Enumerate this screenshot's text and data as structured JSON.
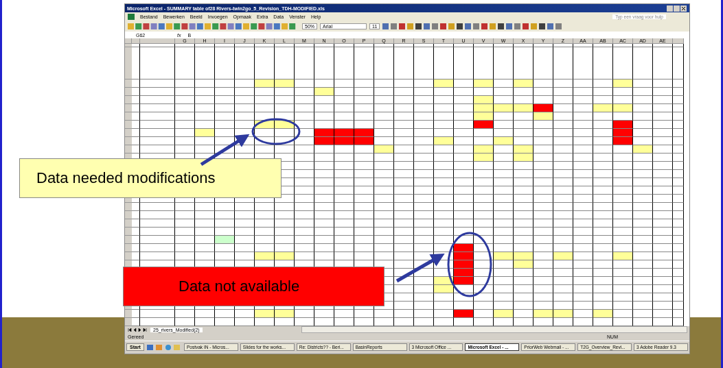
{
  "window": {
    "title": "Microsoft Excel - SUMMARY table of28 Rivers-twin2go_5_Revision_TDH-MODIFIED.xls"
  },
  "menu": [
    "Bestand",
    "Bewerken",
    "Beeld",
    "Invoegen",
    "Opmaak",
    "Extra",
    "Data",
    "Venster",
    "Help"
  ],
  "help_box": {
    "placeholder": "Typ een vraag voor hulp"
  },
  "toolbar": {
    "zoom": "50%",
    "font": "Arial",
    "size": "11"
  },
  "formula_bar": {
    "cell": "G62",
    "fx": "fx",
    "value": "B"
  },
  "columns": [
    "G",
    "H",
    "I",
    "J",
    "K",
    "L",
    "M",
    "N",
    "O",
    "P",
    "Q",
    "R",
    "S",
    "T",
    "U",
    "V",
    "W",
    "X",
    "Y",
    "Z",
    "AA",
    "AB",
    "AC",
    "AD",
    "AE"
  ],
  "rows": [
    {
      "cells": [
        {},
        {},
        {},
        {},
        {
          "color": "#ffff99"
        },
        {
          "color": "#ffff99"
        },
        {},
        {},
        {},
        {},
        {},
        {},
        {},
        {
          "color": "#ffff99"
        },
        {},
        {
          "color": "#ffff99"
        },
        {},
        {
          "color": "#ffff99"
        },
        {},
        {},
        {},
        {},
        {
          "color": "#ffff99"
        },
        {},
        {}
      ]
    },
    {
      "cells": [
        {},
        {},
        {},
        {},
        {},
        {},
        {},
        {
          "color": "#ffff99"
        },
        {},
        {},
        {},
        {},
        {},
        {},
        {},
        {},
        {},
        {},
        {},
        {},
        {},
        {},
        {},
        {},
        {}
      ]
    },
    {
      "cells": [
        {},
        {},
        {},
        {},
        {},
        {},
        {},
        {},
        {},
        {},
        {},
        {},
        {},
        {},
        {},
        {
          "color": "#ffff99"
        },
        {},
        {},
        {},
        {},
        {},
        {},
        {},
        {},
        {}
      ]
    },
    {
      "cells": [
        {},
        {},
        {},
        {},
        {},
        {},
        {},
        {},
        {},
        {},
        {},
        {},
        {},
        {},
        {},
        {
          "color": "#ffff99"
        },
        {
          "color": "#ffff99"
        },
        {
          "color": "#ffff99"
        },
        {
          "color": "#ff0000"
        },
        {},
        {},
        {
          "color": "#ffff99"
        },
        {
          "color": "#ffff99"
        },
        {},
        {}
      ]
    },
    {
      "cells": [
        {},
        {},
        {},
        {},
        {},
        {},
        {},
        {},
        {},
        {},
        {},
        {},
        {},
        {},
        {},
        {
          "color": "#ffff99"
        },
        {},
        {},
        {
          "color": "#ffff99"
        },
        {},
        {},
        {},
        {},
        {},
        {}
      ]
    },
    {
      "cells": [
        {},
        {},
        {},
        {},
        {
          "color": "#ffff99"
        },
        {
          "color": "#ffff99"
        },
        {},
        {},
        {},
        {},
        {},
        {},
        {},
        {},
        {},
        {
          "color": "#ff0000"
        },
        {},
        {},
        {},
        {},
        {},
        {},
        {
          "color": "#ff0000"
        },
        {},
        {}
      ]
    },
    {
      "cells": [
        {},
        {
          "color": "#ffff99"
        },
        {},
        {},
        {},
        {},
        {},
        {
          "color": "#ff0000"
        },
        {
          "color": "#ff0000"
        },
        {
          "color": "#ff0000"
        },
        {},
        {},
        {},
        {},
        {},
        {},
        {},
        {},
        {},
        {},
        {},
        {},
        {
          "color": "#ff0000"
        },
        {},
        {}
      ]
    },
    {
      "cells": [
        {},
        {},
        {},
        {},
        {},
        {},
        {},
        {
          "color": "#ff0000"
        },
        {
          "color": "#ff0000"
        },
        {
          "color": "#ff0000"
        },
        {},
        {},
        {},
        {
          "color": "#ffff99"
        },
        {},
        {},
        {
          "color": "#ffff99"
        },
        {},
        {},
        {},
        {},
        {},
        {
          "color": "#ff0000"
        },
        {},
        {}
      ]
    },
    {
      "cells": [
        {},
        {},
        {},
        {},
        {},
        {},
        {},
        {},
        {},
        {},
        {
          "color": "#ffff99"
        },
        {},
        {},
        {},
        {},
        {
          "color": "#ffff99"
        },
        {},
        {
          "color": "#ffff99"
        },
        {},
        {},
        {},
        {},
        {},
        {
          "color": "#ffff99"
        },
        {}
      ]
    },
    {
      "cells": [
        {},
        {},
        {},
        {},
        {},
        {},
        {},
        {},
        {},
        {},
        {},
        {},
        {},
        {},
        {},
        {
          "color": "#ffff99"
        },
        {},
        {
          "color": "#ffff99"
        },
        {},
        {},
        {},
        {},
        {},
        {},
        {}
      ]
    },
    {
      "cells": [
        {},
        {},
        {},
        {},
        {},
        {},
        {},
        {},
        {},
        {},
        {},
        {},
        {},
        {},
        {},
        {},
        {},
        {},
        {},
        {},
        {},
        {},
        {},
        {},
        {}
      ]
    },
    {
      "cells": [
        {},
        {},
        {},
        {},
        {},
        {},
        {},
        {},
        {},
        {},
        {},
        {},
        {},
        {},
        {},
        {},
        {},
        {},
        {},
        {},
        {},
        {},
        {},
        {},
        {}
      ]
    },
    {
      "cells": [
        {},
        {},
        {},
        {},
        {},
        {},
        {},
        {},
        {},
        {},
        {},
        {},
        {},
        {},
        {},
        {},
        {},
        {},
        {},
        {},
        {},
        {},
        {},
        {},
        {}
      ]
    },
    {
      "cells": [
        {},
        {},
        {},
        {},
        {},
        {},
        {},
        {},
        {},
        {},
        {},
        {},
        {},
        {},
        {},
        {},
        {},
        {},
        {},
        {},
        {},
        {},
        {},
        {},
        {}
      ]
    },
    {
      "cells": [
        {},
        {},
        {},
        {},
        {},
        {},
        {},
        {},
        {},
        {},
        {},
        {},
        {},
        {},
        {},
        {},
        {},
        {},
        {},
        {},
        {},
        {},
        {},
        {},
        {}
      ]
    },
    {
      "cells": [
        {},
        {},
        {},
        {},
        {},
        {},
        {},
        {},
        {},
        {},
        {},
        {},
        {},
        {},
        {},
        {},
        {},
        {},
        {},
        {},
        {},
        {},
        {},
        {},
        {}
      ]
    },
    {
      "cells": [
        {},
        {},
        {},
        {},
        {},
        {},
        {},
        {},
        {},
        {},
        {},
        {},
        {},
        {},
        {},
        {},
        {},
        {},
        {},
        {},
        {},
        {},
        {},
        {},
        {}
      ]
    },
    {
      "cells": [
        {},
        {},
        {},
        {},
        {},
        {},
        {},
        {},
        {},
        {},
        {},
        {},
        {},
        {},
        {},
        {},
        {},
        {},
        {},
        {},
        {},
        {},
        {},
        {},
        {}
      ]
    },
    {
      "cells": [
        {},
        {},
        {},
        {},
        {},
        {},
        {},
        {},
        {},
        {},
        {},
        {},
        {},
        {},
        {},
        {},
        {},
        {},
        {},
        {},
        {},
        {},
        {},
        {},
        {}
      ]
    },
    {
      "cells": [
        {},
        {},
        {
          "color": "#ccffcc"
        },
        {},
        {},
        {},
        {},
        {},
        {},
        {},
        {},
        {},
        {},
        {},
        {},
        {},
        {},
        {},
        {},
        {},
        {},
        {},
        {},
        {},
        {}
      ]
    },
    {
      "cells": [
        {},
        {},
        {},
        {},
        {},
        {},
        {},
        {},
        {},
        {},
        {},
        {},
        {},
        {},
        {
          "color": "#ff0000"
        },
        {},
        {},
        {},
        {},
        {},
        {},
        {},
        {},
        {},
        {}
      ]
    },
    {
      "cells": [
        {},
        {},
        {},
        {},
        {
          "color": "#ffff99"
        },
        {
          "color": "#ffff99"
        },
        {},
        {},
        {},
        {},
        {},
        {},
        {},
        {},
        {
          "color": "#ff0000"
        },
        {},
        {
          "color": "#ffff99"
        },
        {
          "color": "#ffff99"
        },
        {},
        {
          "color": "#ffff99"
        },
        {},
        {},
        {
          "color": "#ffff99"
        },
        {},
        {}
      ]
    },
    {
      "cells": [
        {},
        {},
        {},
        {},
        {},
        {},
        {},
        {},
        {},
        {},
        {},
        {},
        {},
        {},
        {
          "color": "#ff0000"
        },
        {},
        {},
        {
          "color": "#ffff99"
        },
        {},
        {},
        {},
        {},
        {},
        {},
        {}
      ]
    },
    {
      "cells": [
        {},
        {},
        {},
        {},
        {},
        {},
        {},
        {},
        {},
        {},
        {},
        {},
        {},
        {},
        {
          "color": "#ff0000"
        },
        {},
        {},
        {},
        {},
        {},
        {},
        {},
        {},
        {},
        {}
      ]
    },
    {
      "cells": [
        {},
        {},
        {},
        {},
        {},
        {},
        {},
        {},
        {},
        {},
        {},
        {},
        {},
        {
          "color": "#ffff99"
        },
        {
          "color": "#ff0000"
        },
        {},
        {},
        {},
        {},
        {},
        {},
        {},
        {},
        {},
        {}
      ]
    },
    {
      "cells": [
        {},
        {},
        {},
        {},
        {},
        {},
        {},
        {},
        {},
        {},
        {},
        {},
        {},
        {
          "color": "#ffff99"
        },
        {},
        {},
        {},
        {},
        {},
        {},
        {},
        {},
        {},
        {},
        {}
      ]
    },
    {
      "cells": [
        {},
        {},
        {},
        {},
        {},
        {},
        {},
        {},
        {},
        {},
        {},
        {},
        {},
        {},
        {},
        {},
        {},
        {},
        {},
        {},
        {},
        {},
        {},
        {},
        {}
      ]
    },
    {
      "cells": [
        {},
        {},
        {},
        {},
        {},
        {},
        {},
        {},
        {},
        {},
        {},
        {},
        {},
        {},
        {},
        {},
        {},
        {},
        {},
        {},
        {},
        {},
        {},
        {},
        {}
      ]
    },
    {
      "cells": [
        {},
        {},
        {},
        {},
        {
          "color": "#ffff99"
        },
        {
          "color": "#ffff99"
        },
        {},
        {},
        {},
        {},
        {},
        {},
        {},
        {},
        {
          "color": "#ff0000"
        },
        {},
        {
          "color": "#ffff99"
        },
        {},
        {
          "color": "#ffff99"
        },
        {
          "color": "#ffff99"
        },
        {},
        {
          "color": "#ffff99"
        },
        {},
        {},
        {}
      ]
    },
    {
      "cells": [
        {},
        {},
        {},
        {},
        {},
        {},
        {},
        {},
        {},
        {},
        {},
        {},
        {},
        {},
        {},
        {},
        {},
        {},
        {},
        {},
        {},
        {},
        {},
        {},
        {}
      ]
    }
  ],
  "sheet_tab": "25_rivers_Modified(2)",
  "status_bar": {
    "left": "Gereed",
    "right": "NUM"
  },
  "taskbar": {
    "start": "Start",
    "items": [
      {
        "label": "Postvak IN - Micros...",
        "selected": false
      },
      {
        "label": "Slides for the works...",
        "selected": false
      },
      {
        "label": "Re: Districts?? - Beri...",
        "selected": false
      },
      {
        "label": "BasinReports",
        "selected": false
      },
      {
        "label": "3 Microsoft Office ...",
        "selected": false
      },
      {
        "label": "Microsoft Excel - ...",
        "selected": true
      },
      {
        "label": "PriorWeb Webmail - ...",
        "selected": false
      },
      {
        "label": "T2G_Overview_Revi...",
        "selected": false
      },
      {
        "label": "3 Adobe Reader 9.3",
        "selected": false
      }
    ]
  },
  "callouts": [
    {
      "kind": "modify",
      "text": "Data needed modifications"
    },
    {
      "kind": "unavailable",
      "text": "Data not available"
    }
  ]
}
